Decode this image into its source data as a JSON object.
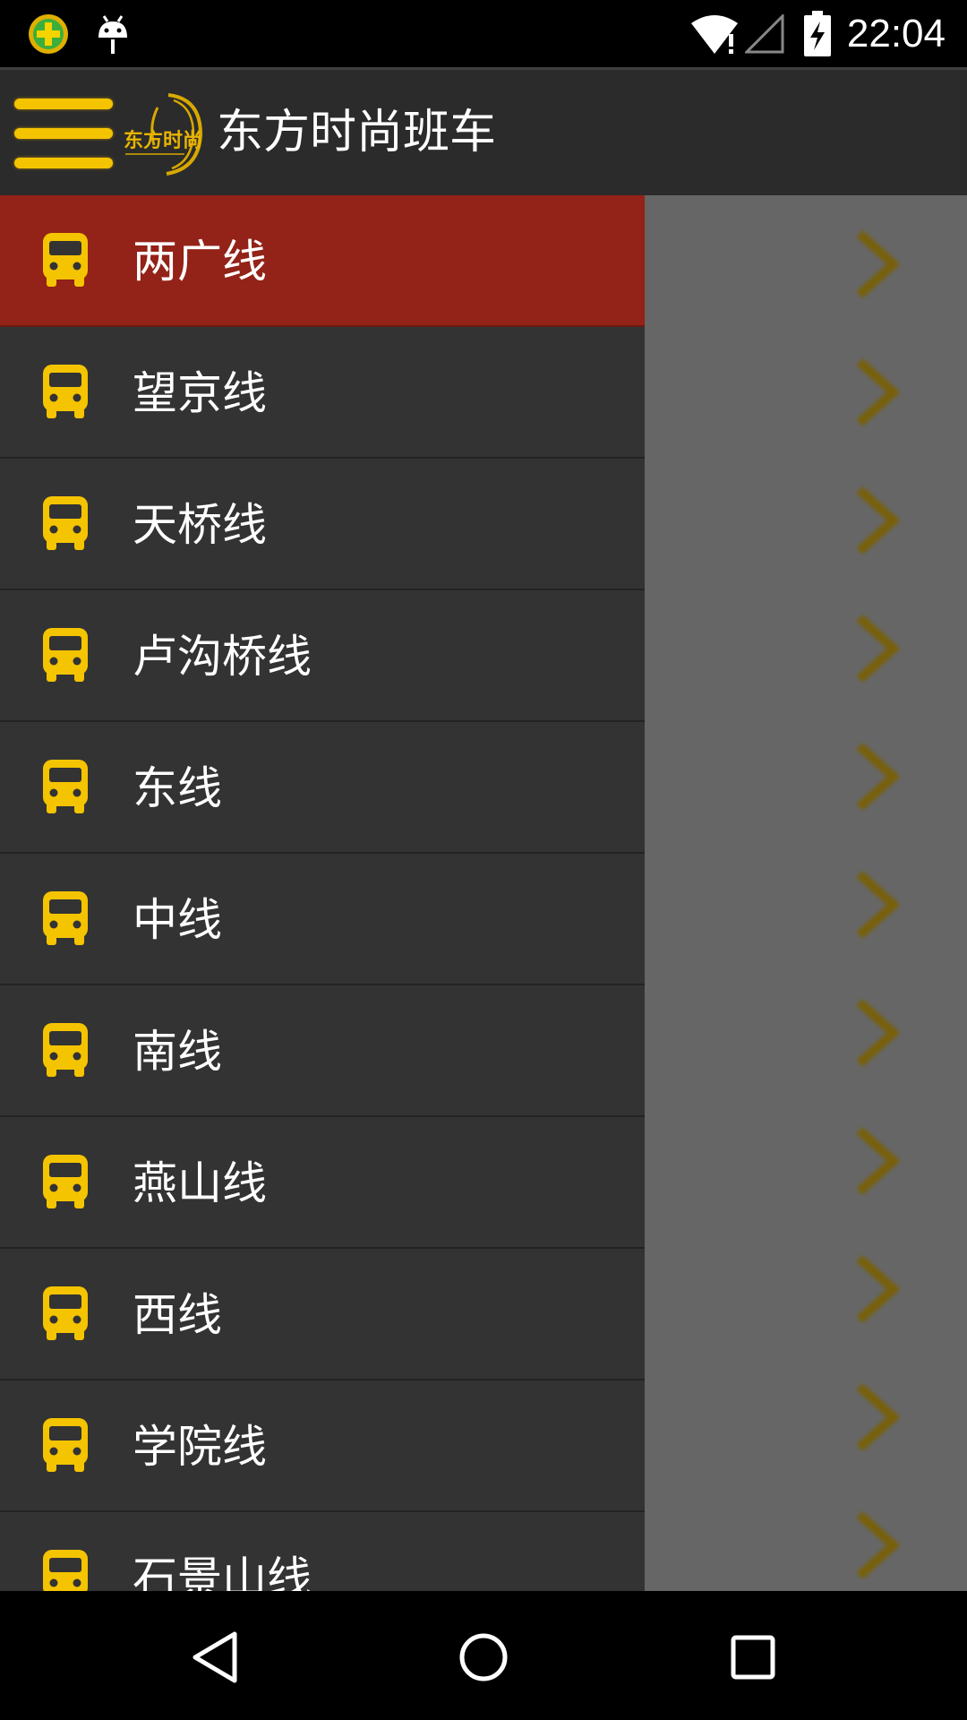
{
  "status_bar": {
    "time": "22:04",
    "icons": [
      "app-notification-icon",
      "android-debug-icon",
      "wifi-icon",
      "cell-signal-icon",
      "battery-charging-icon"
    ]
  },
  "header": {
    "title": "东方时尚班车",
    "menu_icon": "hamburger-menu-icon",
    "logo": "dongfang-shishang-logo",
    "accent_color": "#f5c400",
    "background_color": "#2b2b2b"
  },
  "drawer": {
    "selected_index": 0,
    "selected_color": "#932218",
    "item_icon": "bus-icon",
    "items": [
      {
        "label": "两广线"
      },
      {
        "label": "望京线"
      },
      {
        "label": "天桥线"
      },
      {
        "label": "卢沟桥线"
      },
      {
        "label": "东线"
      },
      {
        "label": "中线"
      },
      {
        "label": "南线"
      },
      {
        "label": "燕山线"
      },
      {
        "label": "西线"
      },
      {
        "label": "学院线"
      },
      {
        "label": "石景山线"
      }
    ]
  },
  "navigation_bar": {
    "buttons": [
      "back-icon",
      "home-icon",
      "recents-icon"
    ]
  }
}
